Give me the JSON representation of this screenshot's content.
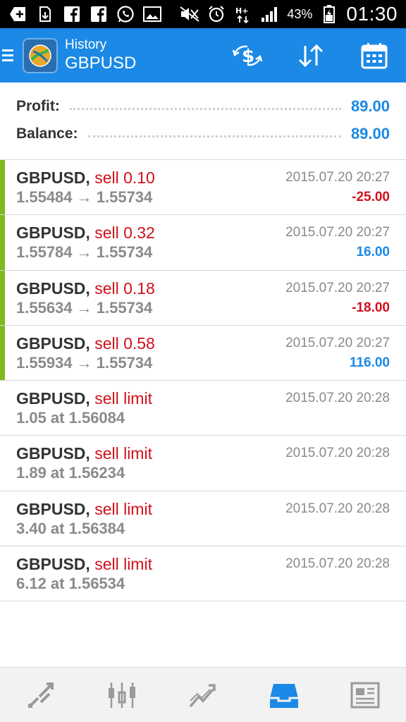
{
  "status_bar": {
    "battery": "43%",
    "clock": "01:30",
    "icons": [
      "add-icon",
      "download-icon",
      "facebook-icon",
      "facebook-icon",
      "whatsapp-icon",
      "image-icon",
      "mute-icon",
      "alarm-icon",
      "data-icon",
      "signal-icon",
      "battery-icon"
    ]
  },
  "header": {
    "title_small": "History",
    "title_large": "GBPUSD",
    "actions": [
      "currency-exchange-icon",
      "sort-icon",
      "calendar-icon"
    ]
  },
  "summary": {
    "profit_label": "Profit:",
    "profit_value": "89.00",
    "balance_label": "Balance:",
    "balance_value": "89.00"
  },
  "colors": {
    "accent_blue": "#1b89e5",
    "sell_red": "#d0111b",
    "closed_green": "#7fba1e"
  },
  "trades": [
    {
      "symbol": "GBPUSD,",
      "type": "sell 0.10",
      "prices": "1.55484 → 1.55734",
      "time": "2015.07.20 20:27",
      "profit": "-25.00",
      "profit_sign": "neg",
      "closed": true
    },
    {
      "symbol": "GBPUSD,",
      "type": "sell 0.32",
      "prices": "1.55784 → 1.55734",
      "time": "2015.07.20 20:27",
      "profit": "16.00",
      "profit_sign": "pos",
      "closed": true
    },
    {
      "symbol": "GBPUSD,",
      "type": "sell 0.18",
      "prices": "1.55634 → 1.55734",
      "time": "2015.07.20 20:27",
      "profit": "-18.00",
      "profit_sign": "neg",
      "closed": true
    },
    {
      "symbol": "GBPUSD,",
      "type": "sell 0.58",
      "prices": "1.55934 → 1.55734",
      "time": "2015.07.20 20:27",
      "profit": "116.00",
      "profit_sign": "pos",
      "closed": true
    },
    {
      "symbol": "GBPUSD,",
      "type": "sell limit",
      "prices": "1.05 at 1.56084",
      "time": "2015.07.20 20:28",
      "profit": "",
      "profit_sign": "",
      "closed": false
    },
    {
      "symbol": "GBPUSD,",
      "type": "sell limit",
      "prices": "1.89 at 1.56234",
      "time": "2015.07.20 20:28",
      "profit": "",
      "profit_sign": "",
      "closed": false
    },
    {
      "symbol": "GBPUSD,",
      "type": "sell limit",
      "prices": "3.40 at 1.56384",
      "time": "2015.07.20 20:28",
      "profit": "",
      "profit_sign": "",
      "closed": false
    },
    {
      "symbol": "GBPUSD,",
      "type": "sell limit",
      "prices": "6.12 at 1.56534",
      "time": "2015.07.20 20:28",
      "profit": "",
      "profit_sign": "",
      "closed": false
    }
  ],
  "bottom_nav": [
    "quotes-icon",
    "chart-icon",
    "trade-icon",
    "history-icon",
    "news-icon"
  ],
  "bottom_nav_active": "history-icon"
}
